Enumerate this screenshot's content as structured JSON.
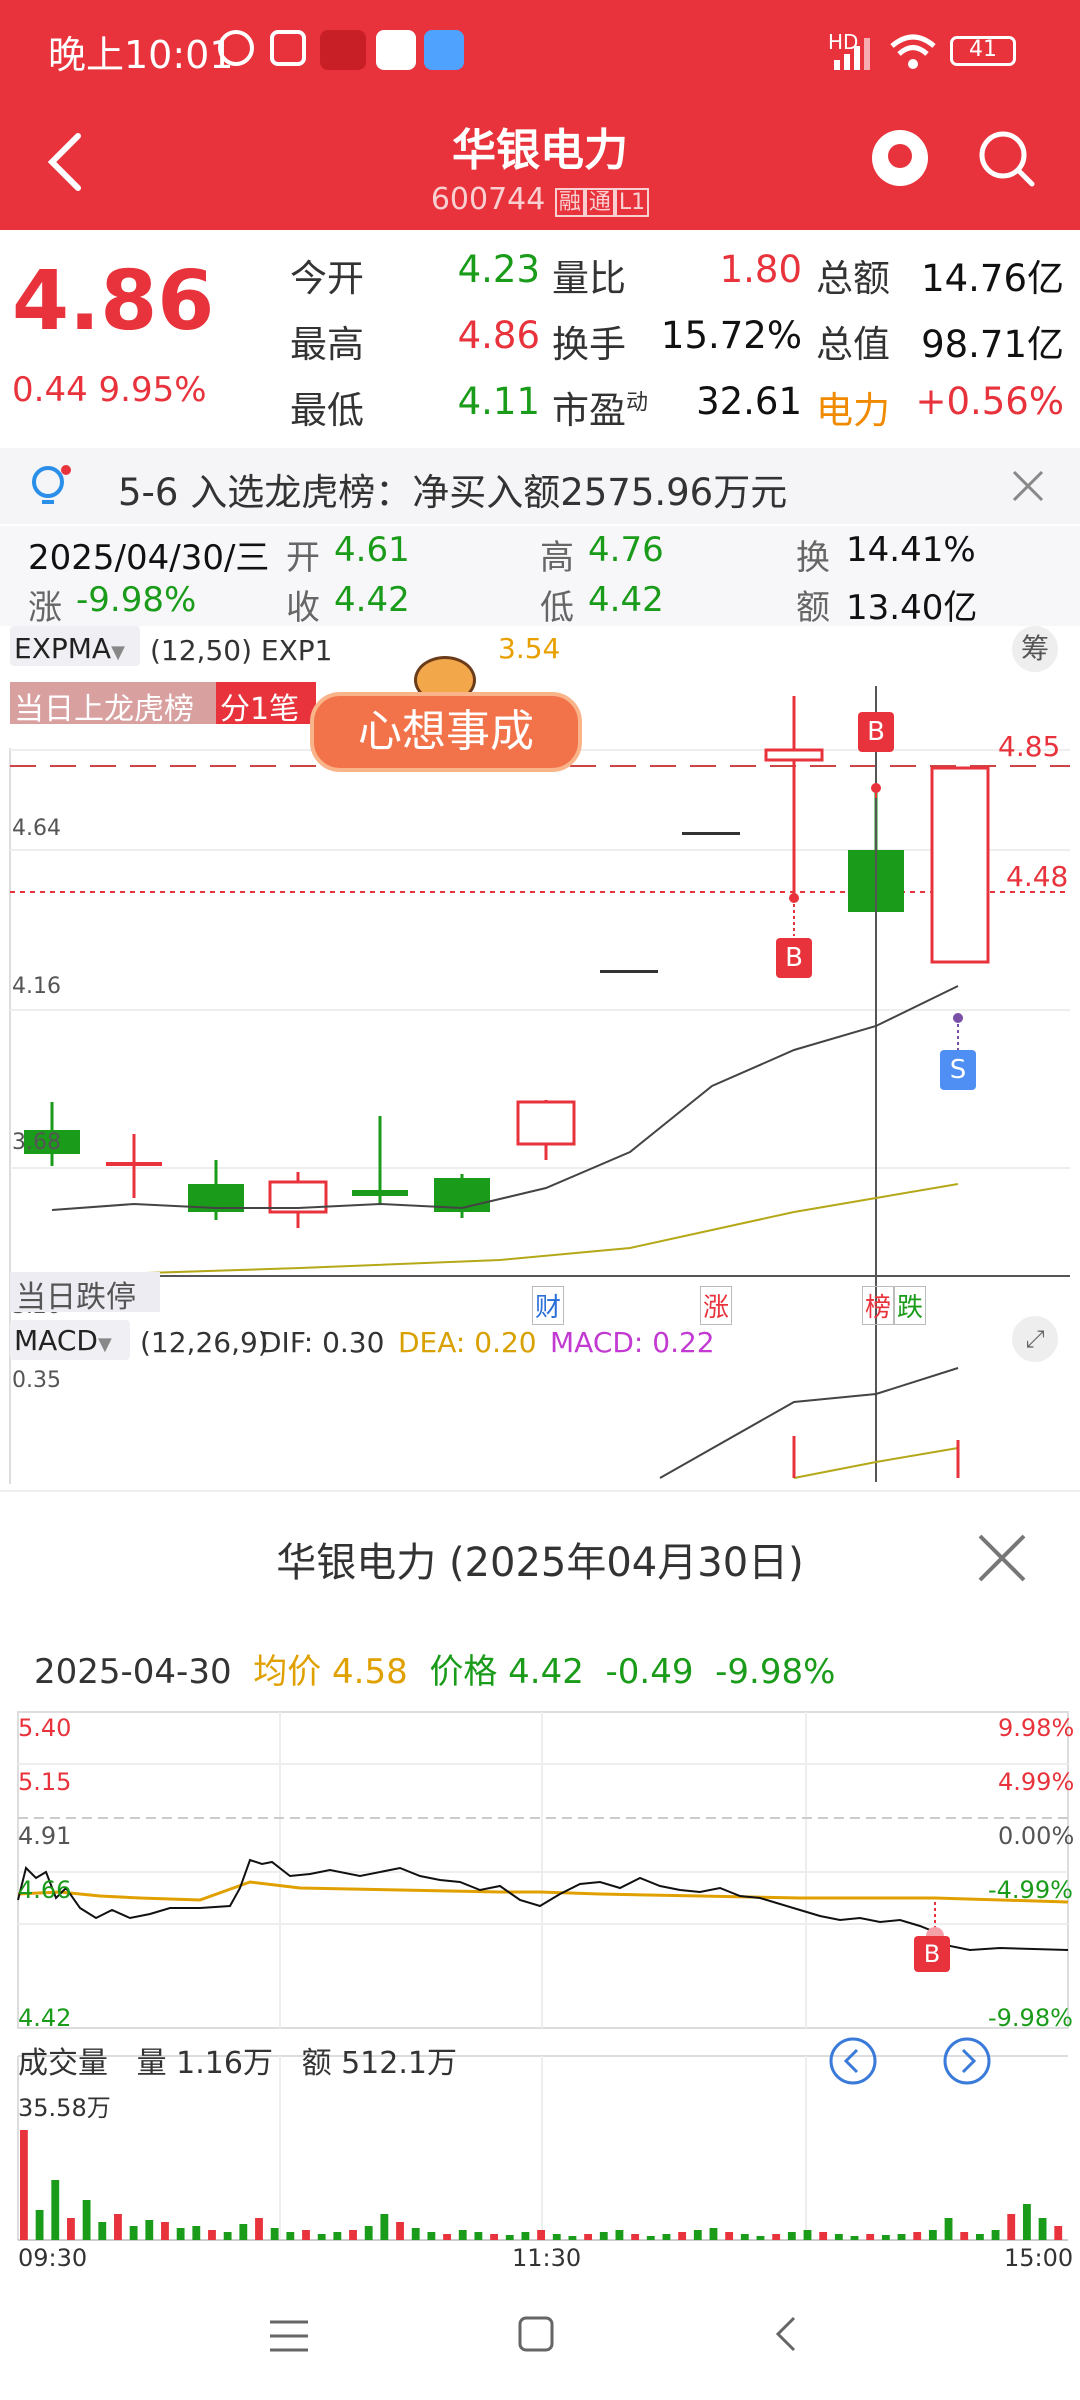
{
  "status_bar": {
    "time": "晚上10:01",
    "battery": "41",
    "network": "HD"
  },
  "header": {
    "title": "华银电力",
    "code": "600744",
    "tags": [
      "融",
      "通",
      "L1"
    ]
  },
  "quote": {
    "price": "4.86",
    "change": "0.44",
    "change_pct": "9.95%",
    "rows": [
      {
        "l1": "今开",
        "v1": "4.23",
        "l2": "量比",
        "v2": "1.80",
        "l3": "总额",
        "v3": "14.76亿"
      },
      {
        "l1": "最高",
        "v1": "4.86",
        "l2": "换手",
        "v2": "15.72%",
        "l3": "总值",
        "v3": "98.71亿"
      },
      {
        "l1": "最低",
        "v1": "4.11",
        "l2": "市盈",
        "l2sup": "动",
        "v2": "32.61",
        "l3": "电力",
        "v3": "+0.56%"
      }
    ]
  },
  "notice": {
    "text": "5-6 入选龙虎榜：净买入额2575.96万元"
  },
  "day_info": {
    "date": "2025/04/30/三",
    "open_label": "开",
    "open": "4.61",
    "high_label": "高",
    "high": "4.76",
    "turnover_label": "换",
    "turnover": "14.41%",
    "change_label": "涨",
    "change": "-9.98%",
    "close_label": "收",
    "close": "4.42",
    "low_label": "低",
    "low": "4.42",
    "amount_label": "额",
    "amount": "13.40亿"
  },
  "kline": {
    "indicator": "EXPMA",
    "params": "(12,50) EXP1",
    "exp_tail": "3.54",
    "badge_left": "当日上龙虎榜",
    "badge_right": "分1笔",
    "sticker": "心想事成",
    "chip": "筹",
    "levels": {
      "top": "4.85",
      "mid": "4.48"
    },
    "axis": [
      "4.64",
      "4.16",
      "3.68",
      "3.20"
    ],
    "bottom_label": "当日跌停",
    "tags": [
      "财",
      "涨",
      "榜",
      "跌"
    ],
    "markers": [
      "B",
      "B",
      "S"
    ]
  },
  "macd": {
    "label": "MACD",
    "params": "(12,26,9)",
    "dif": "DIF: 0.30",
    "dea": "DEA: 0.20",
    "macd": "MACD: 0.22",
    "axis_top": "0.35"
  },
  "intraday": {
    "title": "华银电力 (2025年04月30日)",
    "date": "2025-04-30",
    "avg_label": "均价",
    "avg": "4.58",
    "price_label": "价格",
    "price": "4.42",
    "change": "-0.49",
    "change_pct": "-9.98%",
    "left_axis": [
      "5.40",
      "5.15",
      "4.91",
      "4.66",
      "4.42"
    ],
    "right_axis": [
      "9.98%",
      "4.99%",
      "0.00%",
      "-4.99%",
      "-9.98%"
    ],
    "marker": "B",
    "volume_label": "成交量",
    "volume": "量 1.16万",
    "amount": "额 512.1万",
    "volume_max": "35.58万",
    "times": [
      "09:30",
      "11:30",
      "15:00"
    ]
  },
  "colors": {
    "brand": "#e8333c",
    "up": "#e8333c",
    "down": "#1a9b1a",
    "avg": "#e0a000"
  }
}
